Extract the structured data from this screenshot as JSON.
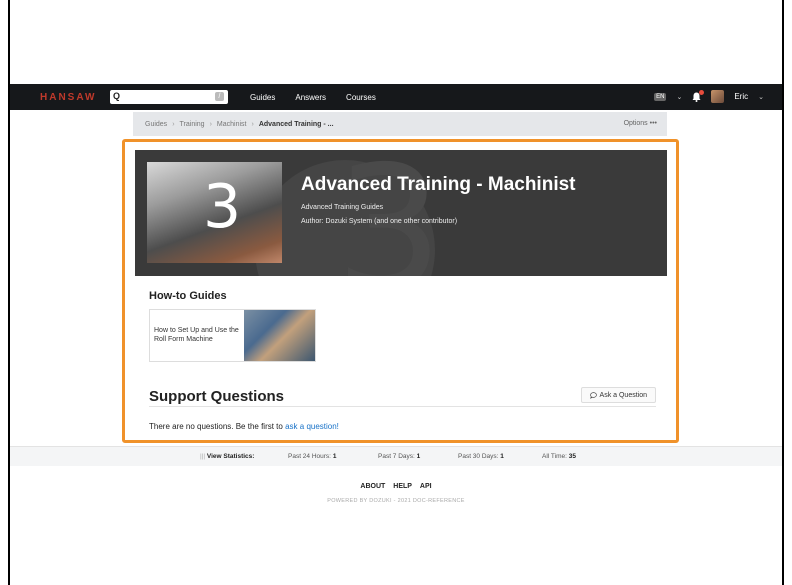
{
  "nav": {
    "brand": "HANSAW",
    "search_icon": "search-icon",
    "search_shortcut": "/",
    "links": [
      "Guides",
      "Answers",
      "Courses"
    ],
    "language": "EN",
    "user_name": "Eric"
  },
  "breadcrumb": {
    "items": [
      "Guides",
      "Training",
      "Machinist",
      "Advanced Training - ..."
    ],
    "options_label": "Options",
    "options_icon": "•••"
  },
  "hero": {
    "thumb_number": "3",
    "title": "Advanced Training - Machinist",
    "subtitle": "Advanced Training Guides",
    "author": "Author: Dozuki System (and one other contributor)"
  },
  "guides": {
    "heading": "How-to Guides",
    "items": [
      {
        "title": "How to Set Up and Use the Roll Form Machine"
      }
    ]
  },
  "support": {
    "heading": "Support Questions",
    "arrow": "→",
    "ask_button": "Ask a Question",
    "empty_text": "There are no questions. Be the first to",
    "empty_link": "ask a question!"
  },
  "stats": {
    "label": "View Statistics:",
    "past24_label": "Past 24 Hours:",
    "past24": "1",
    "past7_label": "Past 7 Days:",
    "past7": "1",
    "past30_label": "Past 30 Days:",
    "past30": "1",
    "all_label": "All Time:",
    "all": "35"
  },
  "footer": {
    "links": [
      "ABOUT",
      "HELP",
      "API"
    ],
    "powered": "POWERED BY DOZUKI - 2021 DOC-REFERENCE"
  },
  "colors": {
    "highlight": "#f0922a",
    "brand": "#c0392b",
    "link": "#1a73c8"
  }
}
